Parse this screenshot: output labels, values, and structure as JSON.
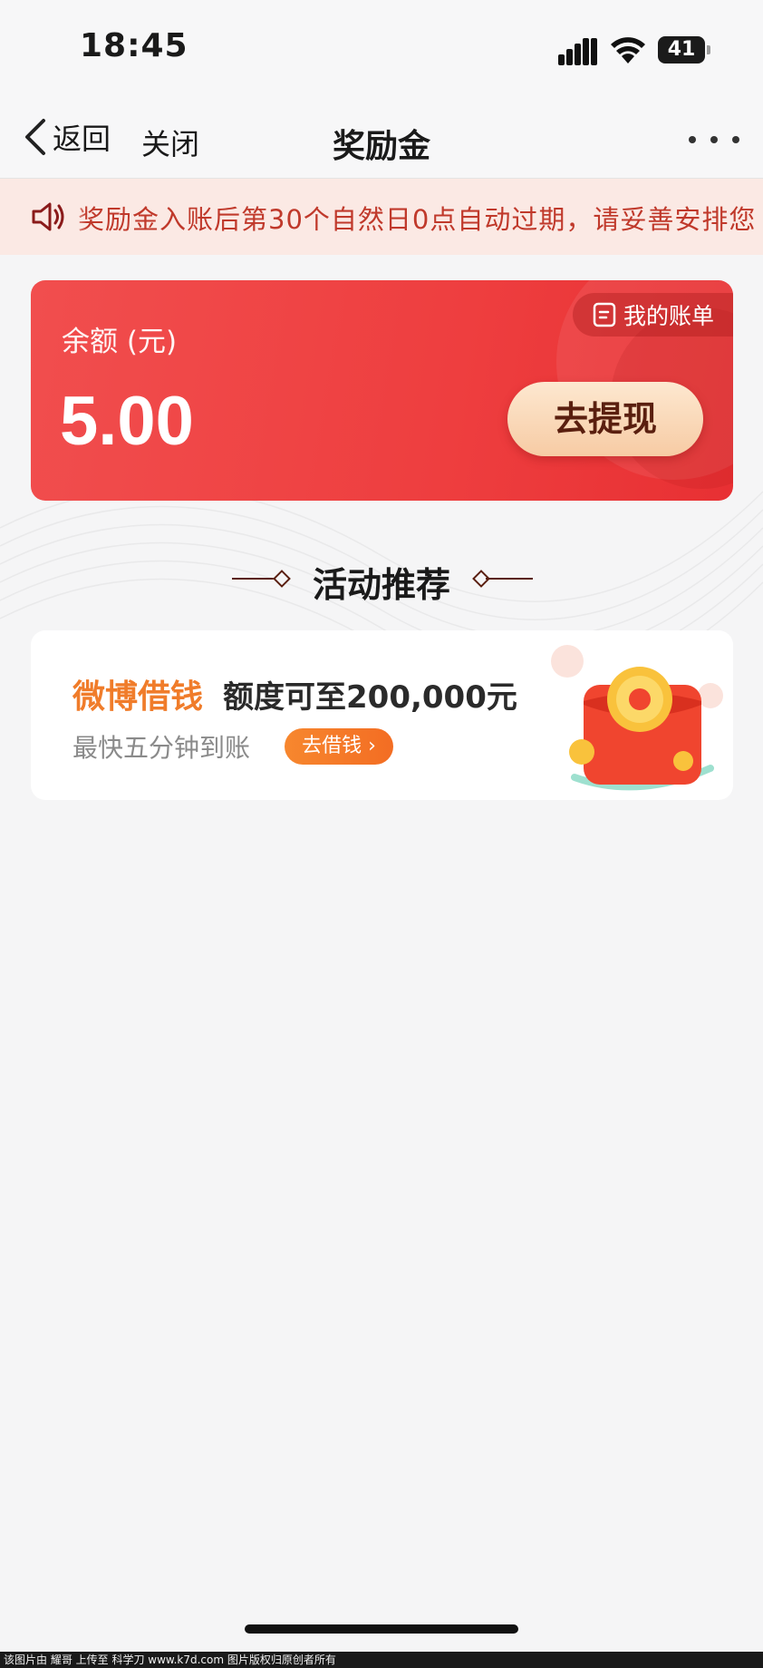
{
  "status_bar": {
    "time": "18:45",
    "battery": "41"
  },
  "nav": {
    "back_label": "返回",
    "close_label": "关闭",
    "title": "奖励金"
  },
  "notice": {
    "text": "奖励金入账后第30个自然日0点自动过期，请妥善安排您"
  },
  "balance": {
    "label": "余额 (元)",
    "value": "5.00",
    "bill_label": "我的账单",
    "withdraw_label": "去提现"
  },
  "section": {
    "title": "活动推荐"
  },
  "promo": {
    "brand": "微博借钱",
    "headline": "额度可至200,000元",
    "subtitle": "最快五分钟到账",
    "button_label": "去借钱 ›"
  },
  "watermark": {
    "text": "该图片由 耀哥 上传至 科学刀 www.k7d.com 图片版权归原创者所有"
  },
  "colors": {
    "accent_red": "#ee3e3f",
    "brand_orange": "#f07c2a",
    "notice_bg": "#fbe9e4"
  }
}
